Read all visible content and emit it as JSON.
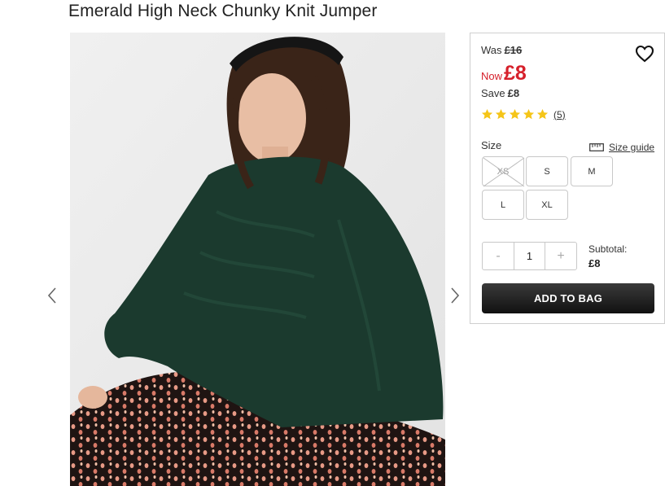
{
  "product": {
    "title": "Emerald High Neck Chunky Knit Jumper"
  },
  "pricing": {
    "was_label": "Was",
    "was_price": "£16",
    "now_label": "Now",
    "now_price": "£8",
    "save_label": "Save",
    "save_amount": "£8",
    "accent_color": "#d6202b"
  },
  "rating": {
    "stars": 5,
    "max_stars": 5,
    "review_count": "(5)",
    "star_color": "#f5c518"
  },
  "size": {
    "label": "Size",
    "guide_label": "Size guide",
    "options": [
      {
        "label": "XS",
        "available": false
      },
      {
        "label": "S",
        "available": true
      },
      {
        "label": "M",
        "available": true
      },
      {
        "label": "L",
        "available": true
      },
      {
        "label": "XL",
        "available": true
      }
    ]
  },
  "quantity": {
    "minus": "-",
    "value": "1",
    "plus": "+"
  },
  "subtotal": {
    "label": "Subtotal:",
    "value": "£8"
  },
  "actions": {
    "add_to_bag": "ADD TO BAG"
  },
  "icons": {
    "wishlist": "heart-outline-icon",
    "size_guide": "ruler-icon",
    "prev": "chevron-left-icon",
    "next": "chevron-right-icon"
  }
}
